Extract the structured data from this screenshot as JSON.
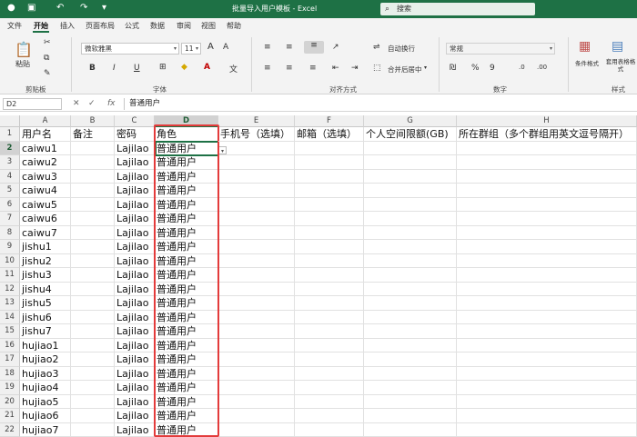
{
  "app": {
    "title": "批量导入用户模板 - Excel",
    "search_placeholder": "搜索",
    "brand_color": "#1e7145"
  },
  "tabs": [
    "文件",
    "开始",
    "插入",
    "页面布局",
    "公式",
    "数据",
    "审阅",
    "视图",
    "帮助"
  ],
  "active_tab": "开始",
  "ribbon": {
    "clipboard": {
      "label": "剪贴板",
      "paste": "粘贴"
    },
    "font": {
      "label": "字体",
      "font_name": "微软雅黑",
      "font_size": "11",
      "bold": "B",
      "italic": "I",
      "underline": "U"
    },
    "alignment": {
      "label": "对齐方式",
      "wrap": "自动换行",
      "merge": "合并后居中"
    },
    "number": {
      "label": "数字",
      "format": "常规"
    },
    "styles": {
      "label": "样式",
      "conditional": "条件格式",
      "table": "套用表格格式"
    }
  },
  "formula_bar": {
    "name_box": "D2",
    "formula": "普通用户",
    "fx": "fx"
  },
  "columns": [
    {
      "letter": "A",
      "header": "用户名"
    },
    {
      "letter": "B",
      "header": "备注"
    },
    {
      "letter": "C",
      "header": "密码"
    },
    {
      "letter": "D",
      "header": "角色"
    },
    {
      "letter": "E",
      "header": "手机号（选填）"
    },
    {
      "letter": "F",
      "header": "邮箱（选填）"
    },
    {
      "letter": "G",
      "header": "个人空间限额(GB)"
    },
    {
      "letter": "H",
      "header": "所在群组（多个群组用英文逗号隔开）"
    }
  ],
  "rows": [
    {
      "num": "1",
      "a": "用户名",
      "b": "备注",
      "c": "密码",
      "d": "角色"
    },
    {
      "num": "2",
      "a": "caiwu1",
      "b": "",
      "c": "Lajilao",
      "d": "普通用户"
    },
    {
      "num": "3",
      "a": "caiwu2",
      "b": "",
      "c": "Lajilao",
      "d": "普通用户"
    },
    {
      "num": "4",
      "a": "caiwu3",
      "b": "",
      "c": "Lajilao",
      "d": "普通用户"
    },
    {
      "num": "5",
      "a": "caiwu4",
      "b": "",
      "c": "Lajilao",
      "d": "普通用户"
    },
    {
      "num": "6",
      "a": "caiwu5",
      "b": "",
      "c": "Lajilao",
      "d": "普通用户"
    },
    {
      "num": "7",
      "a": "caiwu6",
      "b": "",
      "c": "Lajilao",
      "d": "普通用户"
    },
    {
      "num": "8",
      "a": "caiwu7",
      "b": "",
      "c": "Lajilao",
      "d": "普通用户"
    },
    {
      "num": "9",
      "a": "jishu1",
      "b": "",
      "c": "Lajilao",
      "d": "普通用户"
    },
    {
      "num": "10",
      "a": "jishu2",
      "b": "",
      "c": "Lajilao",
      "d": "普通用户"
    },
    {
      "num": "11",
      "a": "jishu3",
      "b": "",
      "c": "Lajilao",
      "d": "普通用户"
    },
    {
      "num": "12",
      "a": "jishu4",
      "b": "",
      "c": "Lajilao",
      "d": "普通用户"
    },
    {
      "num": "13",
      "a": "jishu5",
      "b": "",
      "c": "Lajilao",
      "d": "普通用户"
    },
    {
      "num": "14",
      "a": "jishu6",
      "b": "",
      "c": "Lajilao",
      "d": "普通用户"
    },
    {
      "num": "15",
      "a": "jishu7",
      "b": "",
      "c": "Lajilao",
      "d": "普通用户"
    },
    {
      "num": "16",
      "a": "hujiao1",
      "b": "",
      "c": "Lajilao",
      "d": "普通用户"
    },
    {
      "num": "17",
      "a": "hujiao2",
      "b": "",
      "c": "Lajilao",
      "d": "普通用户"
    },
    {
      "num": "18",
      "a": "hujiao3",
      "b": "",
      "c": "Lajilao",
      "d": "普通用户"
    },
    {
      "num": "19",
      "a": "hujiao4",
      "b": "",
      "c": "Lajilao",
      "d": "普通用户"
    },
    {
      "num": "20",
      "a": "hujiao5",
      "b": "",
      "c": "Lajilao",
      "d": "普通用户"
    },
    {
      "num": "21",
      "a": "hujiao6",
      "b": "",
      "c": "Lajilao",
      "d": "普通用户"
    },
    {
      "num": "22",
      "a": "hujiao7",
      "b": "",
      "c": "Lajilao",
      "d": "普通用户"
    }
  ],
  "selected_cell": "D2"
}
